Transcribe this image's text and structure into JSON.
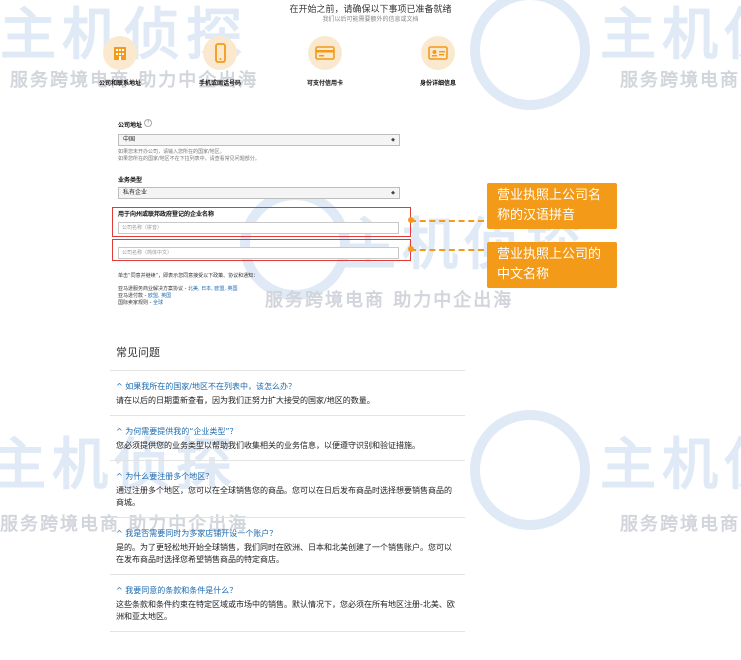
{
  "header": {
    "title": "在开始之前，请确保以下事项已准备就绪",
    "subtitle": "我们以后可能需要额外的信息或文档"
  },
  "steps": [
    {
      "icon": "building-icon",
      "label": "公司和联系地址"
    },
    {
      "icon": "phone-icon",
      "label": "手机或固话号码"
    },
    {
      "icon": "credit-card-icon",
      "label": "可支付信用卡"
    },
    {
      "icon": "id-card-icon",
      "label": "身份详细信息"
    }
  ],
  "form": {
    "company_address_label": "公司地址",
    "company_address_value": "中国",
    "address_hint_1": "如果您未开办公司，请输入您所在的国家/地区。",
    "address_hint_2": "如果您所在的国家/地区不在下拉列表中，请查看常见问题部分。",
    "business_type_label": "业务类型",
    "business_type_value": "私有企业",
    "legal_name_label": "用于向州或联邦政府登记的企业名称",
    "pinyin_placeholder": "公司名称（拼音）",
    "chinese_placeholder": "公司名称（简体中文）",
    "agreement_text": "单击“同意并继续”，即表示您同意接受以下政策、协议和通知：",
    "agreement_1_prefix": "亚马逊服务商业解决方案协议 - ",
    "agreement_1_links": "北美, 日本, 欧盟, 英国",
    "agreement_2_prefix": "亚马逊付款 - ",
    "agreement_2_links": "欧盟, 英国",
    "agreement_3_prefix": "国际卖家规则 - ",
    "agreement_3_links": "全球"
  },
  "callouts": {
    "pinyin": "营业执照上公司名称的汉语拼音",
    "chinese": "营业执照上公司的中文名称"
  },
  "watermark": {
    "brand": "主机侦探",
    "slogan": "服务跨境电商 助力中企出海"
  },
  "faq": {
    "title": "常见问题",
    "items": [
      {
        "q": "如果我所在的国家/地区不在列表中，该怎么办？",
        "a": "请在以后的日期重新查看，因为我们正努力扩大接受的国家/地区的数量。"
      },
      {
        "q": "为何需要提供我的“企业类型”？",
        "a": "您必须提供您的业务类型以帮助我们收集相关的业务信息，以便遵守识别和验证措施。"
      },
      {
        "q": "为什么要注册多个地区？",
        "a": "通过注册多个地区，您可以在全球销售您的商品。您可以在日后发布商品时选择想要销售商品的商城。"
      },
      {
        "q": "我是否需要同时为多家店铺开设一个账户？",
        "a": "是的。为了更轻松地开始全球销售，我们同时在欧洲、日本和北美创建了一个销售账户。您可以在发布商品时选择您希望销售商品的特定商店。"
      },
      {
        "q": "我要同意的条款和条件是什么？",
        "a": "这些条款和条件约束在特定区域或市场中的销售。默认情况下，您必须在所有地区注册-北美、欧洲和亚太地区。"
      }
    ]
  },
  "colors": {
    "accent": "#f39a18",
    "highlight": "#e03a3a",
    "link": "#1a6ab0"
  }
}
